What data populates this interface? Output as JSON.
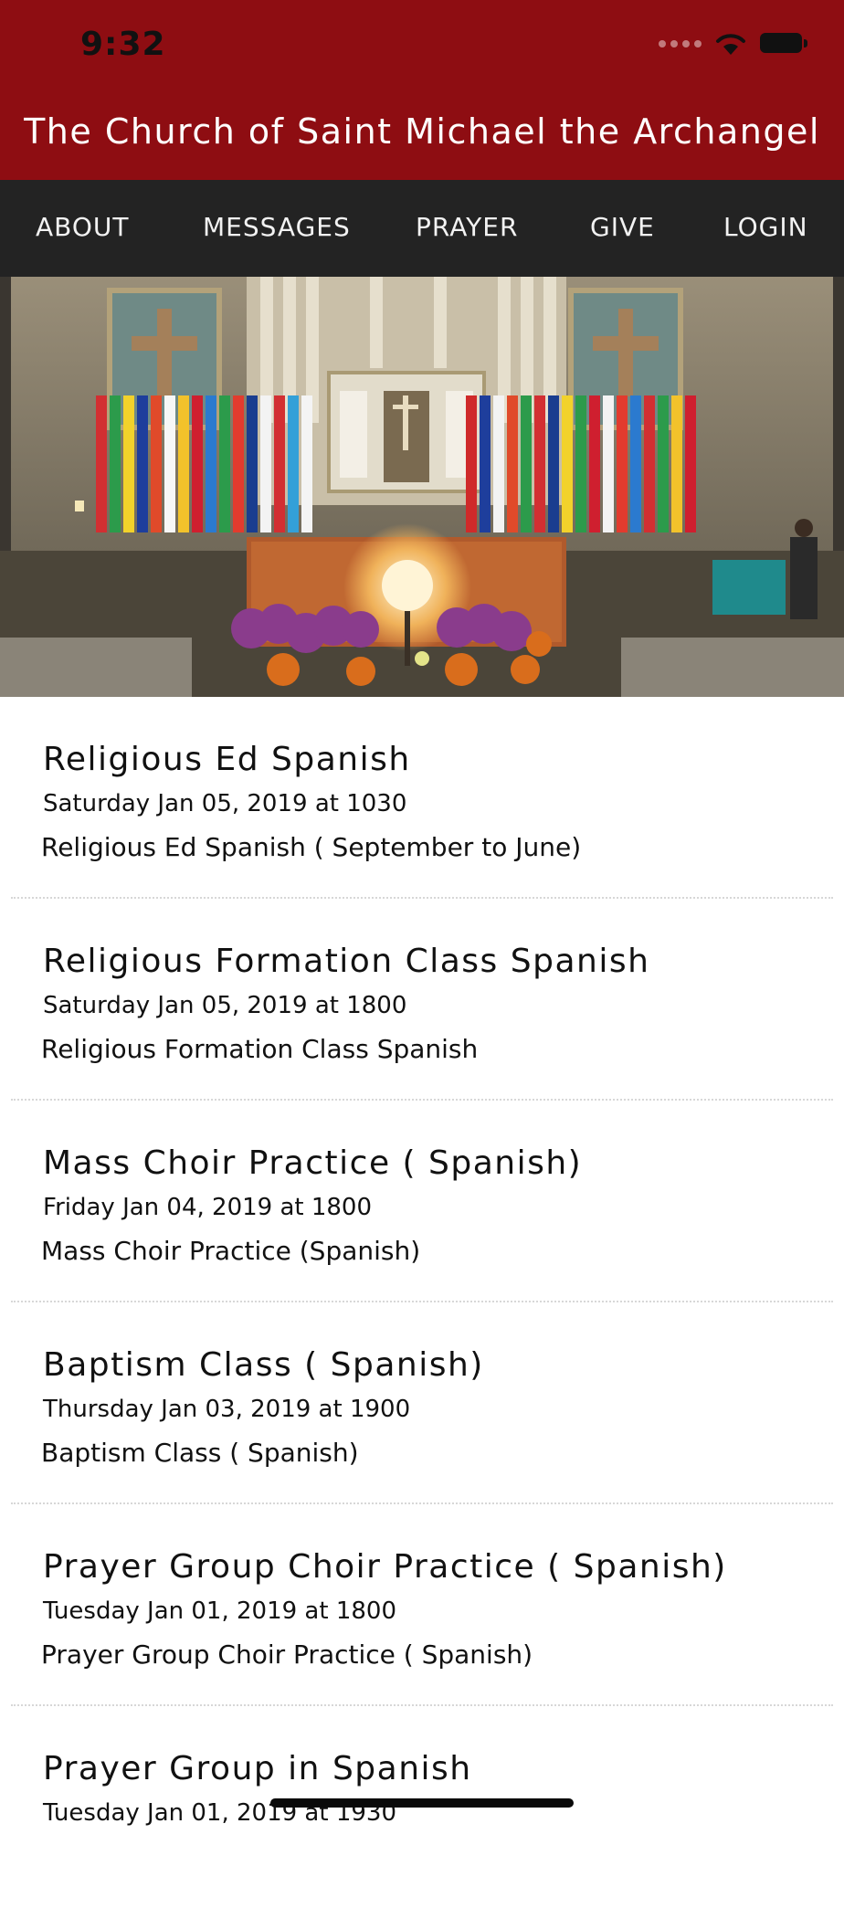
{
  "status_bar": {
    "time": "9:32"
  },
  "header": {
    "title": "The Church of Saint Michael the Archangel",
    "background_color": "#8e0d12"
  },
  "nav": {
    "background_color": "#232323",
    "items": [
      {
        "label": "ABOUT"
      },
      {
        "label": "MESSAGES"
      },
      {
        "label": "PRAYER"
      },
      {
        "label": "GIVE"
      },
      {
        "label": "LOGIN"
      }
    ]
  },
  "hero": {
    "image": "church-altar-with-flags-photo"
  },
  "events": [
    {
      "title": "Religious Ed Spanish",
      "date": "Saturday Jan 05, 2019 at 1030",
      "description": "Religious Ed Spanish ( September to June)"
    },
    {
      "title": "Religious Formation Class Spanish",
      "date": "Saturday Jan 05, 2019 at 1800",
      "description": "Religious Formation Class Spanish"
    },
    {
      "title": "Mass Choir Practice ( Spanish)",
      "date": "Friday Jan 04, 2019 at 1800",
      "description": "Mass Choir Practice (Spanish)"
    },
    {
      "title": "Baptism Class ( Spanish)",
      "date": "Thursday Jan 03, 2019 at 1900",
      "description": "Baptism Class ( Spanish)"
    },
    {
      "title": "Prayer Group Choir Practice ( Spanish)",
      "date": "Tuesday Jan 01, 2019 at 1800",
      "description": "Prayer Group Choir Practice ( Spanish)"
    },
    {
      "title": "Prayer Group in Spanish",
      "date": "Tuesday Jan 01, 2019 at 1930",
      "description": ""
    }
  ]
}
